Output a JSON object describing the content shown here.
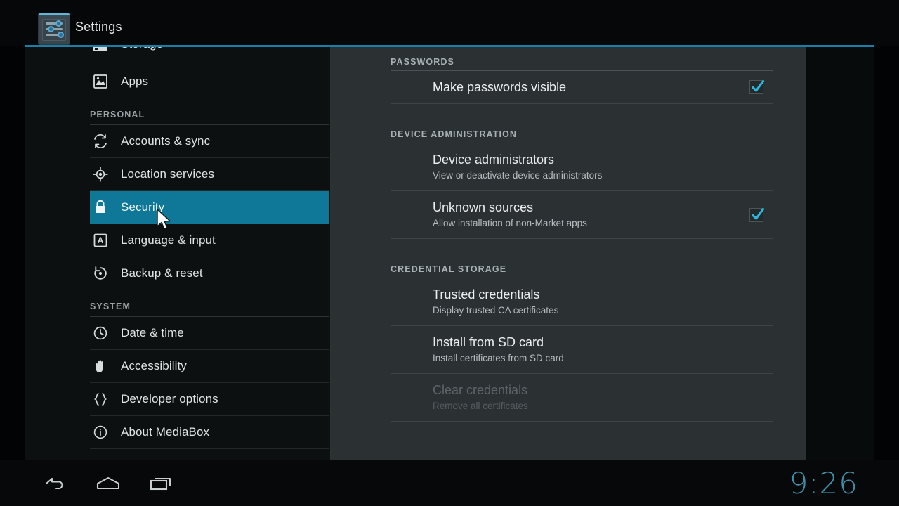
{
  "window": {
    "title": "Settings",
    "app_icon": "settings-sliders-icon"
  },
  "colors": {
    "accent_teal": "#0f7898",
    "title_rule": "#1a7fa8",
    "checkbox_check": "#2cb6e0",
    "clock": "#3f8ea8",
    "sidebar_bg": "#0d1011",
    "content_bg": "#2b3133"
  },
  "sidebar": {
    "items": [
      {
        "label": "Storage",
        "icon": "storage-icon",
        "type": "item",
        "selected": false,
        "partial": true
      },
      {
        "label": "Apps",
        "icon": "apps-icon",
        "type": "item",
        "selected": false
      },
      {
        "label": "PERSONAL",
        "icon": "",
        "type": "header"
      },
      {
        "label": "Accounts & sync",
        "icon": "sync-icon",
        "type": "item",
        "selected": false
      },
      {
        "label": "Location services",
        "icon": "location-icon",
        "type": "item",
        "selected": false
      },
      {
        "label": "Security",
        "icon": "lock-icon",
        "type": "item",
        "selected": true
      },
      {
        "label": "Language & input",
        "icon": "language-icon",
        "type": "item",
        "selected": false
      },
      {
        "label": "Backup & reset",
        "icon": "backup-reset-icon",
        "type": "item",
        "selected": false
      },
      {
        "label": "SYSTEM",
        "icon": "",
        "type": "header"
      },
      {
        "label": "Date & time",
        "icon": "clock-icon",
        "type": "item",
        "selected": false
      },
      {
        "label": "Accessibility",
        "icon": "hand-icon",
        "type": "item",
        "selected": false
      },
      {
        "label": "Developer options",
        "icon": "braces-icon",
        "type": "item",
        "selected": false
      },
      {
        "label": "About MediaBox",
        "icon": "info-circle-icon",
        "type": "item",
        "selected": false
      }
    ]
  },
  "content": {
    "sections": [
      {
        "header": "PASSWORDS",
        "rows": [
          {
            "title": "Make passwords visible",
            "subtitle": "",
            "checkbox": true,
            "checked": true,
            "disabled": false
          }
        ]
      },
      {
        "header": "DEVICE ADMINISTRATION",
        "rows": [
          {
            "title": "Device administrators",
            "subtitle": "View or deactivate device administrators",
            "checkbox": false,
            "checked": false,
            "disabled": false
          },
          {
            "title": "Unknown sources",
            "subtitle": "Allow installation of non-Market apps",
            "checkbox": true,
            "checked": true,
            "disabled": false
          }
        ]
      },
      {
        "header": "CREDENTIAL STORAGE",
        "rows": [
          {
            "title": "Trusted credentials",
            "subtitle": "Display trusted CA certificates",
            "checkbox": false,
            "checked": false,
            "disabled": false
          },
          {
            "title": "Install from SD card",
            "subtitle": "Install certificates from SD card",
            "checkbox": false,
            "checked": false,
            "disabled": false
          },
          {
            "title": "Clear credentials",
            "subtitle": "Remove all certificates",
            "checkbox": false,
            "checked": false,
            "disabled": true
          }
        ]
      }
    ]
  },
  "navbar": {
    "buttons": [
      {
        "name": "back-icon",
        "label": "Back"
      },
      {
        "name": "home-icon",
        "label": "Home"
      },
      {
        "name": "recents-icon",
        "label": "Recent apps"
      }
    ],
    "clock": "9:26"
  }
}
